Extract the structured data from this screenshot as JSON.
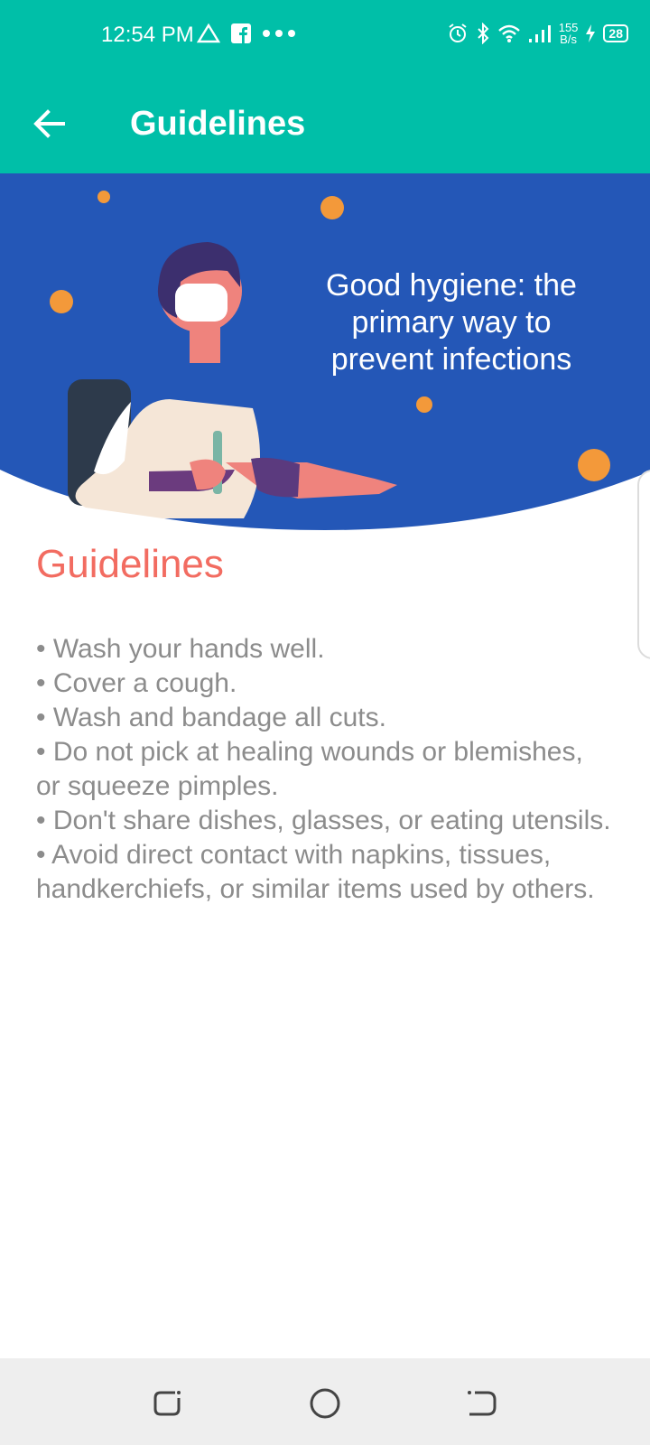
{
  "status_bar": {
    "time": "12:54 PM",
    "net_speed_value": "155",
    "net_speed_unit": "B/s",
    "battery": "28"
  },
  "app_bar": {
    "title": "Guidelines",
    "back_icon": "arrow-left-icon"
  },
  "hero": {
    "text": "Good hygiene: the primary way to prevent infections",
    "colors": {
      "background": "#2457b7",
      "virus": "#f3993a"
    }
  },
  "content": {
    "title": "Guidelines",
    "body": "• Wash your hands well.\n• Cover a cough.\n• Wash and bandage all cuts.\n• Do not pick at healing wounds or blemishes, or squeeze pimples.\n• Don't share dishes, glasses, or eating utensils.\n• Avoid direct contact with napkins, tissues, handkerchiefs, or similar items used by others."
  },
  "colors": {
    "accent": "#00bfa8",
    "title_red": "#f26c61",
    "body_gray": "#8c8c8c"
  }
}
